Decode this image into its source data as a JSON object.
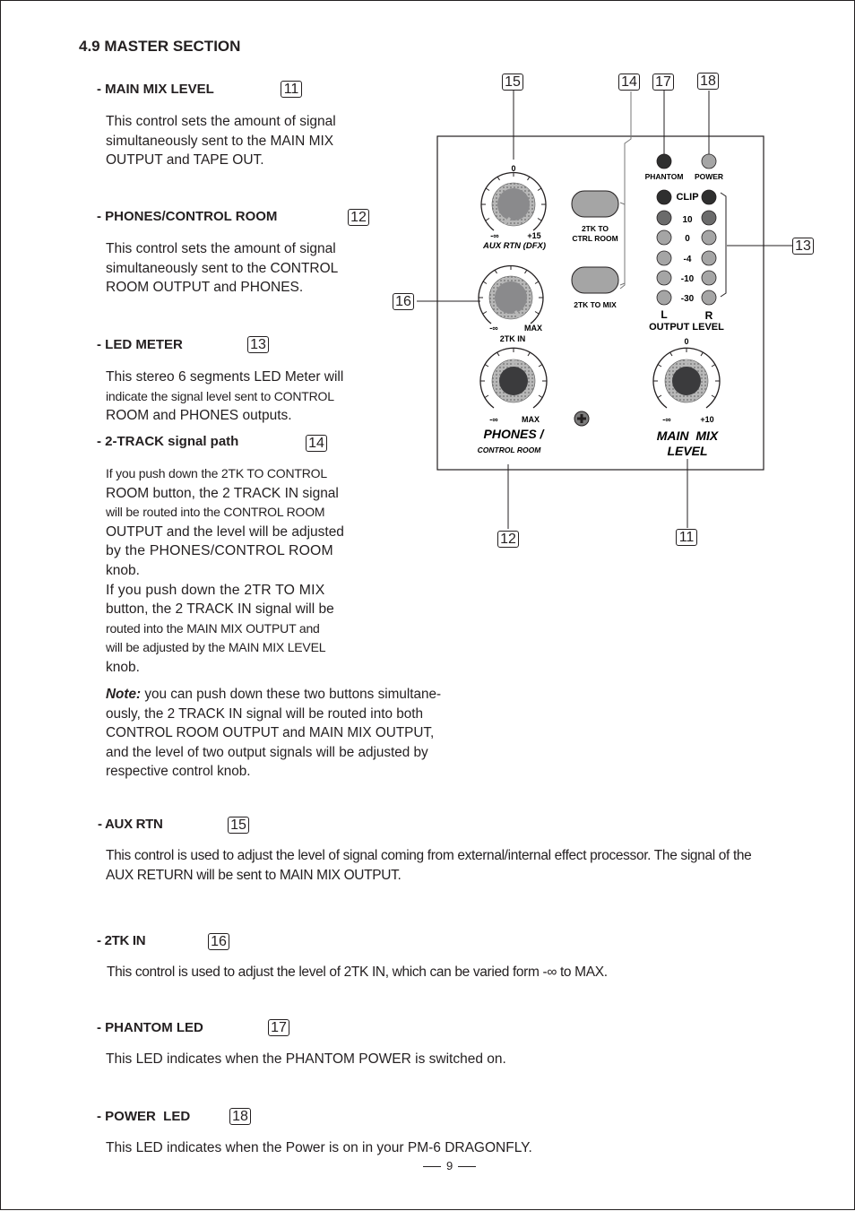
{
  "section_title": "4.9 MASTER SECTION",
  "items": [
    {
      "heading": "- MAIN MIX LEVEL",
      "callout": "11",
      "lines": [
        "This control sets the amount of signal",
        "simultaneously sent to the MAIN MIX",
        "OUTPUT and TAPE OUT."
      ]
    },
    {
      "heading": "- PHONES/CONTROL ROOM",
      "callout": "12",
      "lines": [
        "This control sets the amount of signal",
        "simultaneously sent to the CONTROL",
        "ROOM OUTPUT and PHONES."
      ]
    },
    {
      "heading": "- LED METER",
      "callout": "13",
      "lines": [
        "This stereo 6 segments LED Meter will",
        "indicate the signal level sent to CONTROL",
        "ROOM and PHONES outputs."
      ]
    },
    {
      "heading": "- 2-TRACK signal path",
      "callout": "14",
      "lines": [
        "If you push down the 2TK TO CONTROL",
        "ROOM button, the 2 TRACK IN signal",
        "will be routed into the CONTROL ROOM",
        "OUTPUT and the level will be adjusted",
        "by the PHONES/CONTROL ROOM",
        "knob.",
        "If you push down the 2TR TO MIX",
        "button, the 2 TRACK IN signal will be",
        "routed into the MAIN MIX OUTPUT and",
        "will be adjusted by the MAIN MIX LEVEL",
        "knob."
      ],
      "note_label": "Note:",
      "note_lines": [
        " you can push down these two buttons simultane-",
        "ously, the 2 TRACK IN signal will be routed into both",
        "CONTROL ROOM OUTPUT and MAIN MIX OUTPUT,",
        "and the level of two output signals will be adjusted by",
        "respective control knob."
      ]
    },
    {
      "heading": "- AUX RTN",
      "callout": "15",
      "lines": [
        "This control is used to adjust the level of signal coming from external/internal effect processor. The signal of the",
        "AUX RETURN will be sent to MAIN MIX OUTPUT."
      ]
    },
    {
      "heading": "- 2TK IN",
      "callout": "16",
      "lines": [
        "This control is used to adjust the level of 2TK IN, which can be varied form -∞ to MAX."
      ]
    },
    {
      "heading": "- PHANTOM LED",
      "callout": "17",
      "lines": [
        "This LED indicates when the PHANTOM POWER is switched on."
      ]
    },
    {
      "heading": "- POWER  LED",
      "callout": "18",
      "lines": [
        "This LED indicates when the Power is on in your PM-6 DRAGONFLY."
      ]
    }
  ],
  "diagram": {
    "callouts": {
      "c11": "11",
      "c12": "12",
      "c13": "13",
      "c14": "14",
      "c15": "15",
      "c16": "16",
      "c17": "17",
      "c18": "18"
    },
    "aux_rtn": {
      "top": "0",
      "min": "-∞",
      "max": "+15",
      "label": "AUX RTN (DFX)"
    },
    "tk_in": {
      "min": "-∞",
      "max": "MAX",
      "label": "2TK IN"
    },
    "phones": {
      "min": "-∞",
      "max": "MAX",
      "label": "PHONES /",
      "sublabel": "CONTROL ROOM"
    },
    "main_mix": {
      "top": "0",
      "min": "-∞",
      "max": "+10",
      "label_line1": "MAIN  MIX",
      "label_line2": "LEVEL"
    },
    "buttons": {
      "ctrl_room_line1": "2TK TO",
      "ctrl_room_line2": "CTRL ROOM",
      "to_mix": "2TK TO MIX"
    },
    "leds": {
      "phantom": "PHANTOM",
      "power": "POWER"
    },
    "meter": {
      "segments": [
        "CLIP",
        "10",
        "0",
        "-4",
        "-10",
        "-30"
      ],
      "left": "L",
      "right": "R",
      "title": "OUTPUT LEVEL"
    },
    "colors": {
      "led_dark": "#2f2f2f",
      "led_mid": "#6b6b6b",
      "led_light": "#a5a5a5",
      "knob_dark": "#3b3b3d",
      "knob_grey": "#8a8a8c",
      "knob_ring": "#b5b5b5"
    }
  },
  "page_number": "9"
}
